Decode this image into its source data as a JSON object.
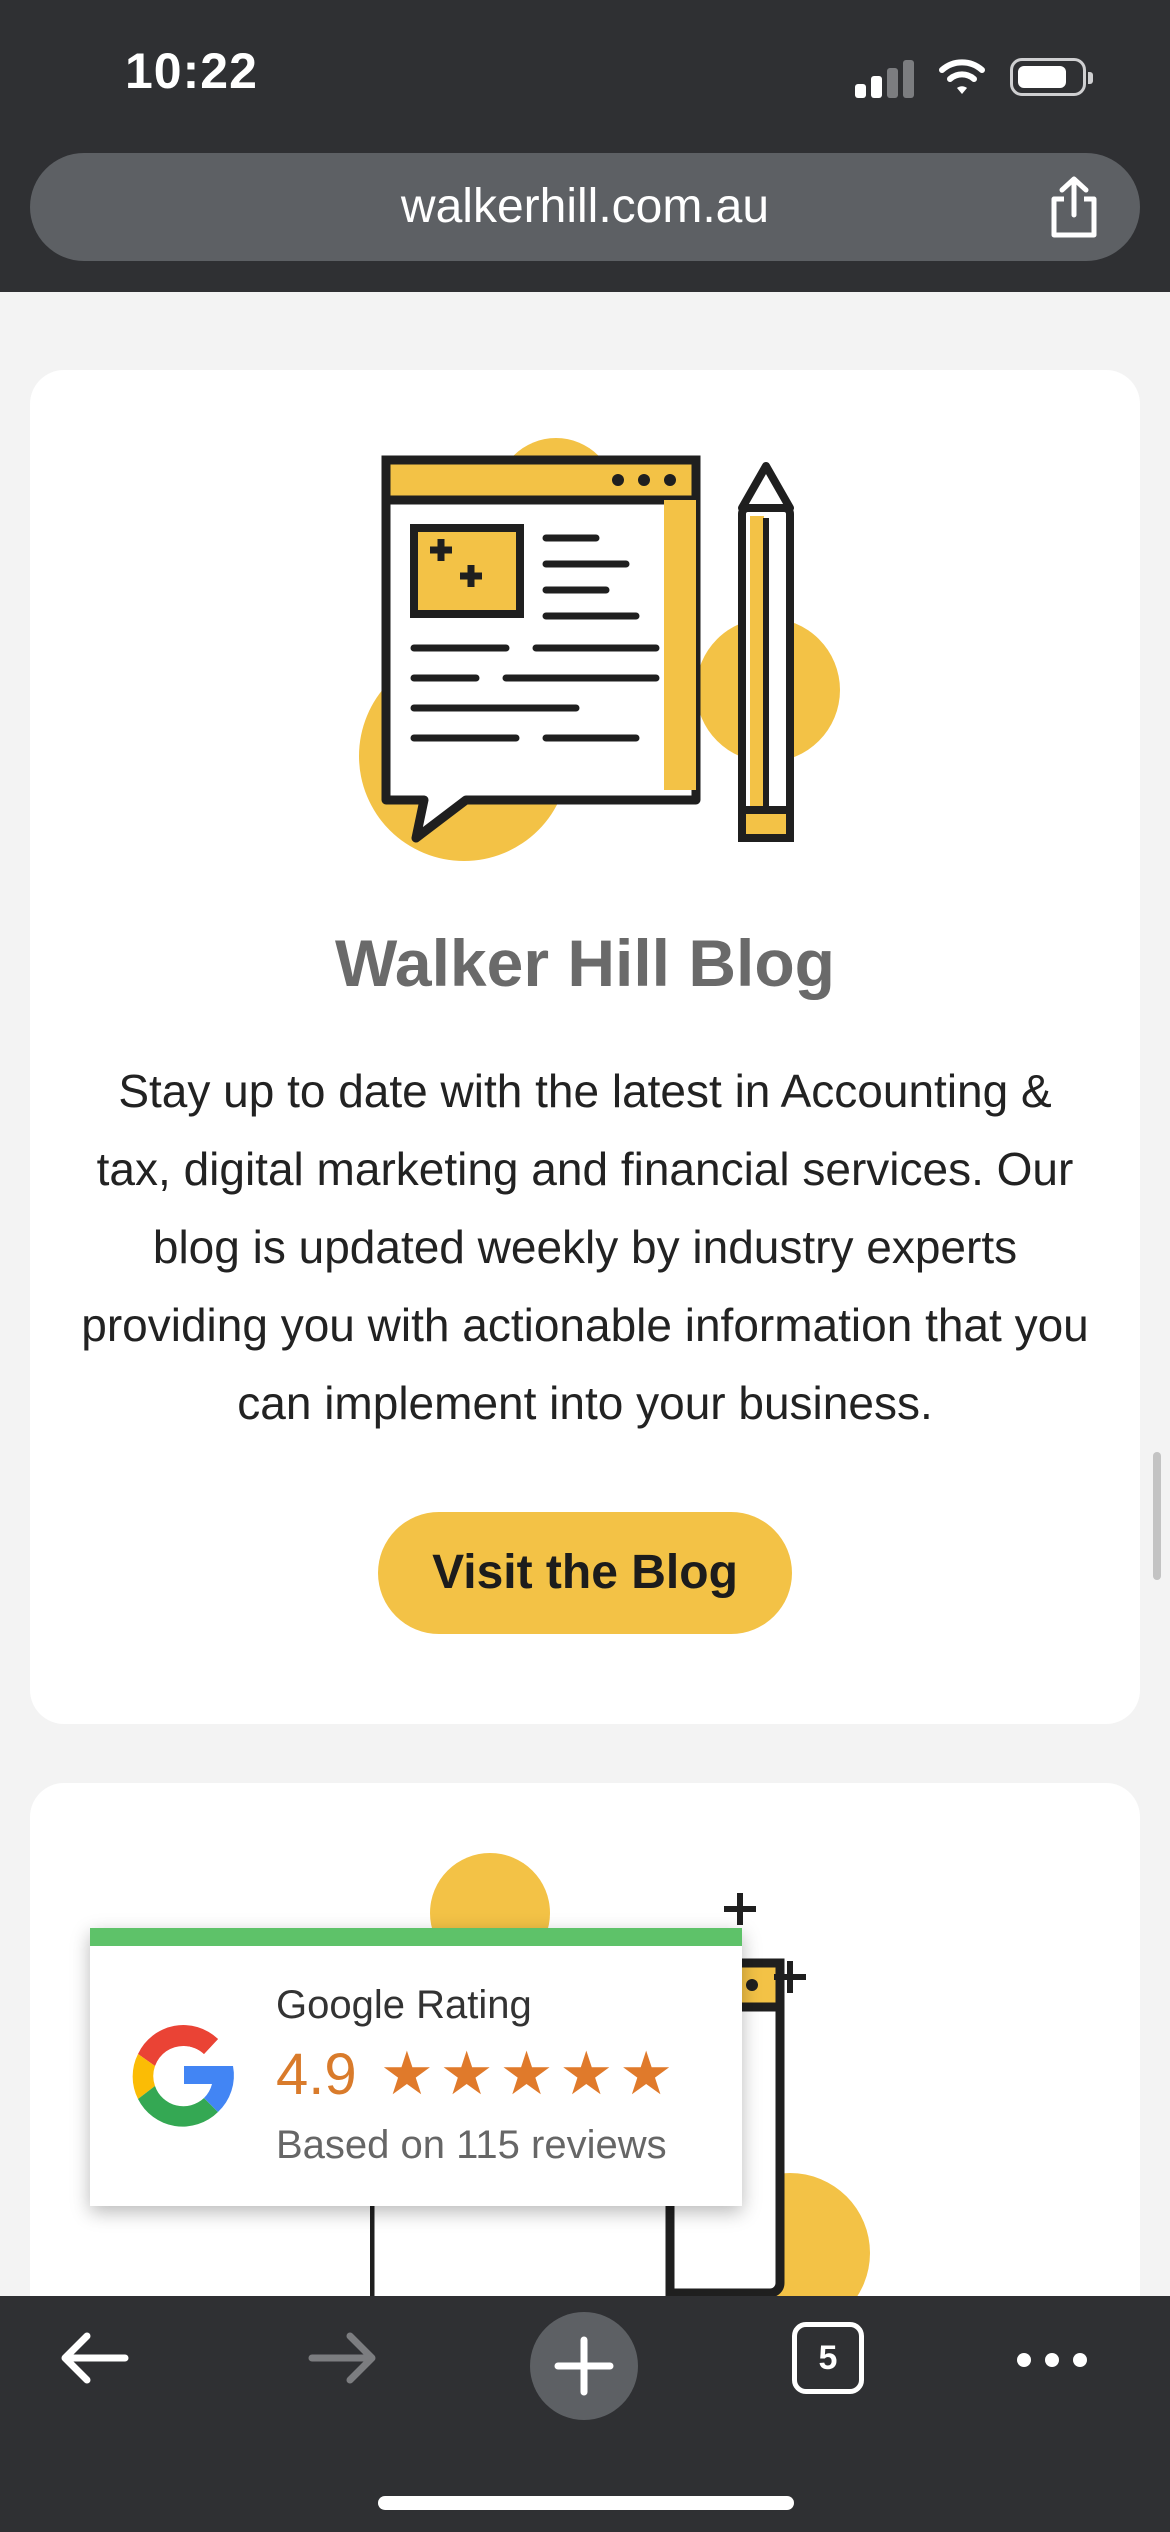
{
  "status_bar": {
    "time": "10:22"
  },
  "browser": {
    "url": "walkerhill.com.au",
    "tab_count": "5"
  },
  "blog_card": {
    "title": "Walker Hill Blog",
    "body": "Stay up to date with the latest in Accounting & tax, digital marketing and financial services. Our blog is updated weekly by industry experts providing you with actionable information that you can implement into your business.",
    "button_label": "Visit the Blog"
  },
  "google_rating": {
    "title": "Google Rating",
    "score": "4.9",
    "stars": 5,
    "based_on": "Based on 115 reviews"
  },
  "colors": {
    "accent": "#f3c246",
    "star": "#e07a2b",
    "stripe": "#5ec269",
    "chrome": "#2f3033"
  },
  "icons": [
    "signal-icon",
    "wifi-icon",
    "battery-icon",
    "share-icon",
    "back-arrow-icon",
    "forward-arrow-icon",
    "plus-icon",
    "tabs-icon",
    "more-icon",
    "google-logo-icon"
  ]
}
